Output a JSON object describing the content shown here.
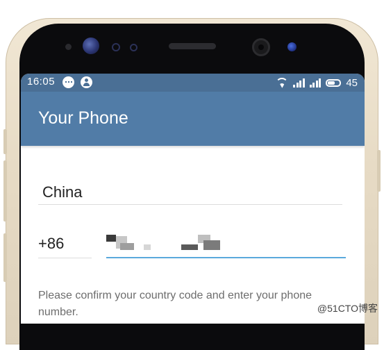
{
  "status_bar": {
    "time": "16:05",
    "battery": "45",
    "icons": [
      "chat-bubble-icon",
      "user-icon",
      "wifi-icon",
      "signal-icon",
      "signal-icon",
      "battery-icon"
    ]
  },
  "app_bar": {
    "title": "Your Phone"
  },
  "form": {
    "country": "China",
    "country_code": "+86",
    "phone_number_redacted": true,
    "help_text": "Please confirm your country code and enter your phone number."
  },
  "watermark": "@51CTO博客",
  "colors": {
    "status_bar": "#4a6f95",
    "app_bar": "#517ca7",
    "accent_underline": "#5aa9dc",
    "device_frame": "#e7dbc5"
  }
}
